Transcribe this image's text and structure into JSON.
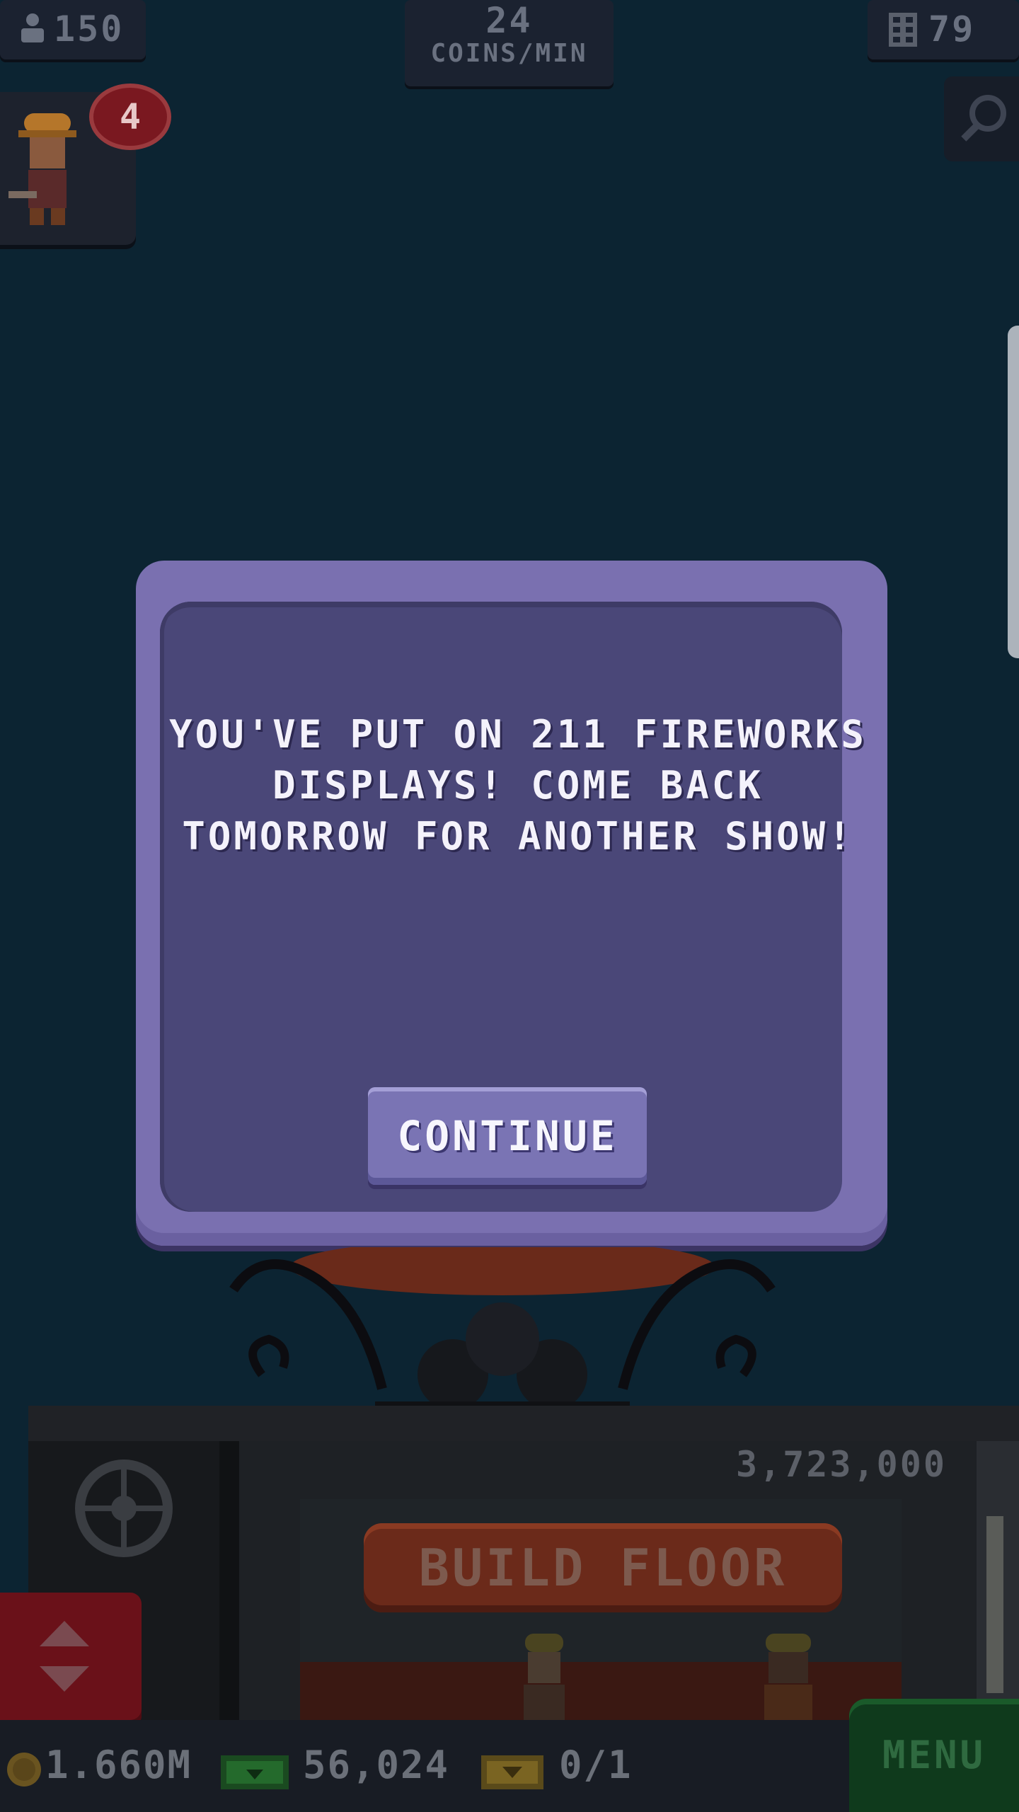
{
  "hud": {
    "population": "150",
    "coins_per_min_value": "24",
    "coins_per_min_label": "COINS/MIN",
    "floors": "79",
    "notification_count": "4"
  },
  "dialog": {
    "message": "YOU'VE PUT ON 211 FIREWORKS DISPLAYS! COME BACK TOMORROW FOR ANOTHER SHOW!",
    "continue_label": "CONTINUE"
  },
  "tower": {
    "floor_cost": "3,723,000",
    "build_floor_label": "BUILD FLOOR"
  },
  "bottom_bar": {
    "coins": "1.660M",
    "bux": "56,024",
    "tickets": "0/1",
    "menu_label": "MENU"
  },
  "colors": {
    "background": "#0c2432",
    "dialog_frame": "#7a70b0",
    "dialog_fill": "#4a4778",
    "build_button": "#6b2a1a",
    "menu_button": "#0f3a1c",
    "badge": "#7a1820"
  },
  "icons": [
    "person-icon",
    "building-icon",
    "search-icon",
    "worker-icon",
    "coin-icon",
    "bux-icon",
    "ticket-icon",
    "elevator-arrows-icon"
  ]
}
